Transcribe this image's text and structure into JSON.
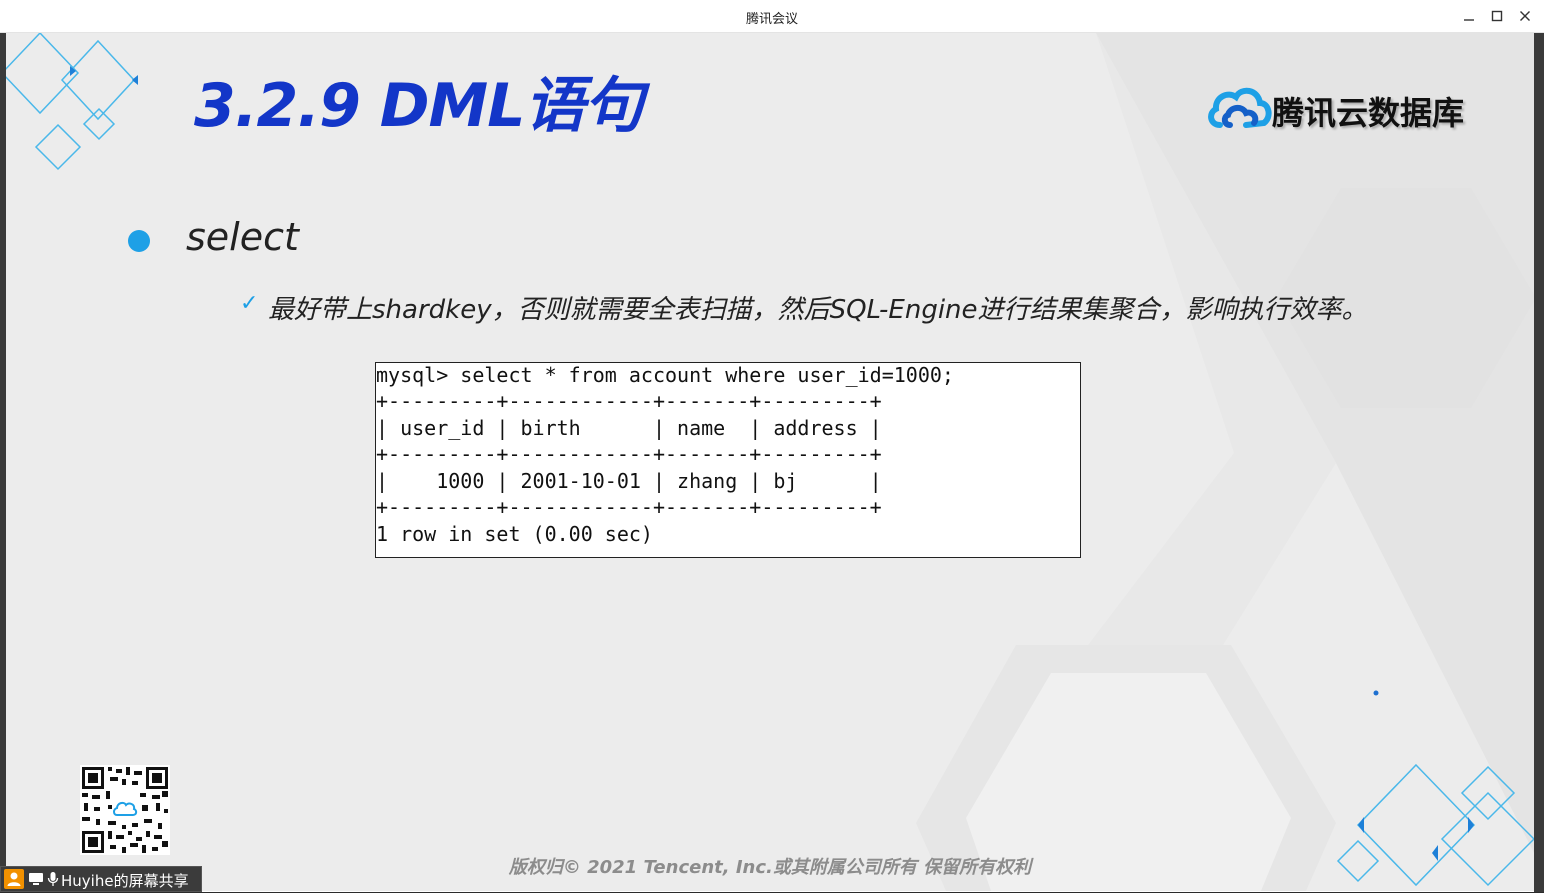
{
  "window": {
    "title": "腾讯会议"
  },
  "slide": {
    "title": "3.2.9 DML语句",
    "brand": "腾讯云数据库",
    "bullet": "select",
    "sub_bullet": "最好带上shardkey，否则就需要全表扫描，然后SQL-Engine进行结果集聚合，影响执行效率。",
    "code_lines": [
      "mysql> select * from account where user_id=1000;",
      "+---------+------------+-------+---------+",
      "| user_id | birth      | name  | address |",
      "+---------+------------+-------+---------+",
      "|    1000 | 2001-10-01 | zhang | bj      |",
      "+---------+------------+-------+---------+",
      "1 row in set (0.00 sec)"
    ],
    "copyright": "版权归© 2021 Tencent, Inc.或其附属公司所有 保留所有权利"
  },
  "share_indicator": {
    "label": "Huyihe的屏幕共享"
  },
  "icons": [
    "minimize-icon",
    "maximize-icon",
    "close-icon",
    "cloud-logo-icon",
    "check-icon",
    "qr-code",
    "user-icon",
    "screen-share-icon",
    "mic-icon"
  ],
  "colors": {
    "title_blue": "#1336c8",
    "accent_cyan": "#1ea0e6",
    "slide_bg": "#ececec"
  }
}
